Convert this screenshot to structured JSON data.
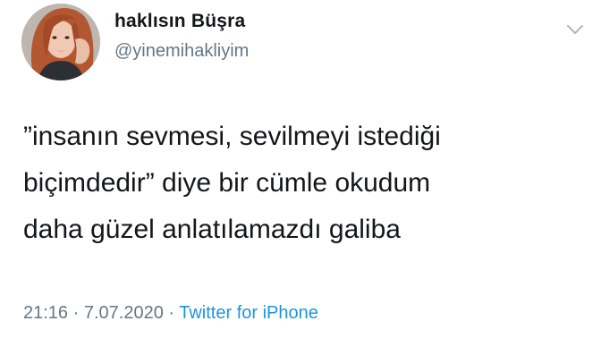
{
  "author": {
    "display_name": "haklısın Büşra",
    "handle": "@yinemihakliyim"
  },
  "tweet": {
    "text": "”insanın sevmesi, sevilmeyi istediği\nbiçimdedir” diye bir cümle okudum\ndaha güzel anlatılamazdı galiba"
  },
  "meta": {
    "time": "21:16",
    "separator": " · ",
    "date": "7.07.2020",
    "source": "Twitter for iPhone"
  },
  "icons": {
    "menu": "chevron-down-icon"
  },
  "colors": {
    "text": "#14171a",
    "secondary": "#657786",
    "link": "#1b95e0",
    "background": "#ffffff"
  }
}
